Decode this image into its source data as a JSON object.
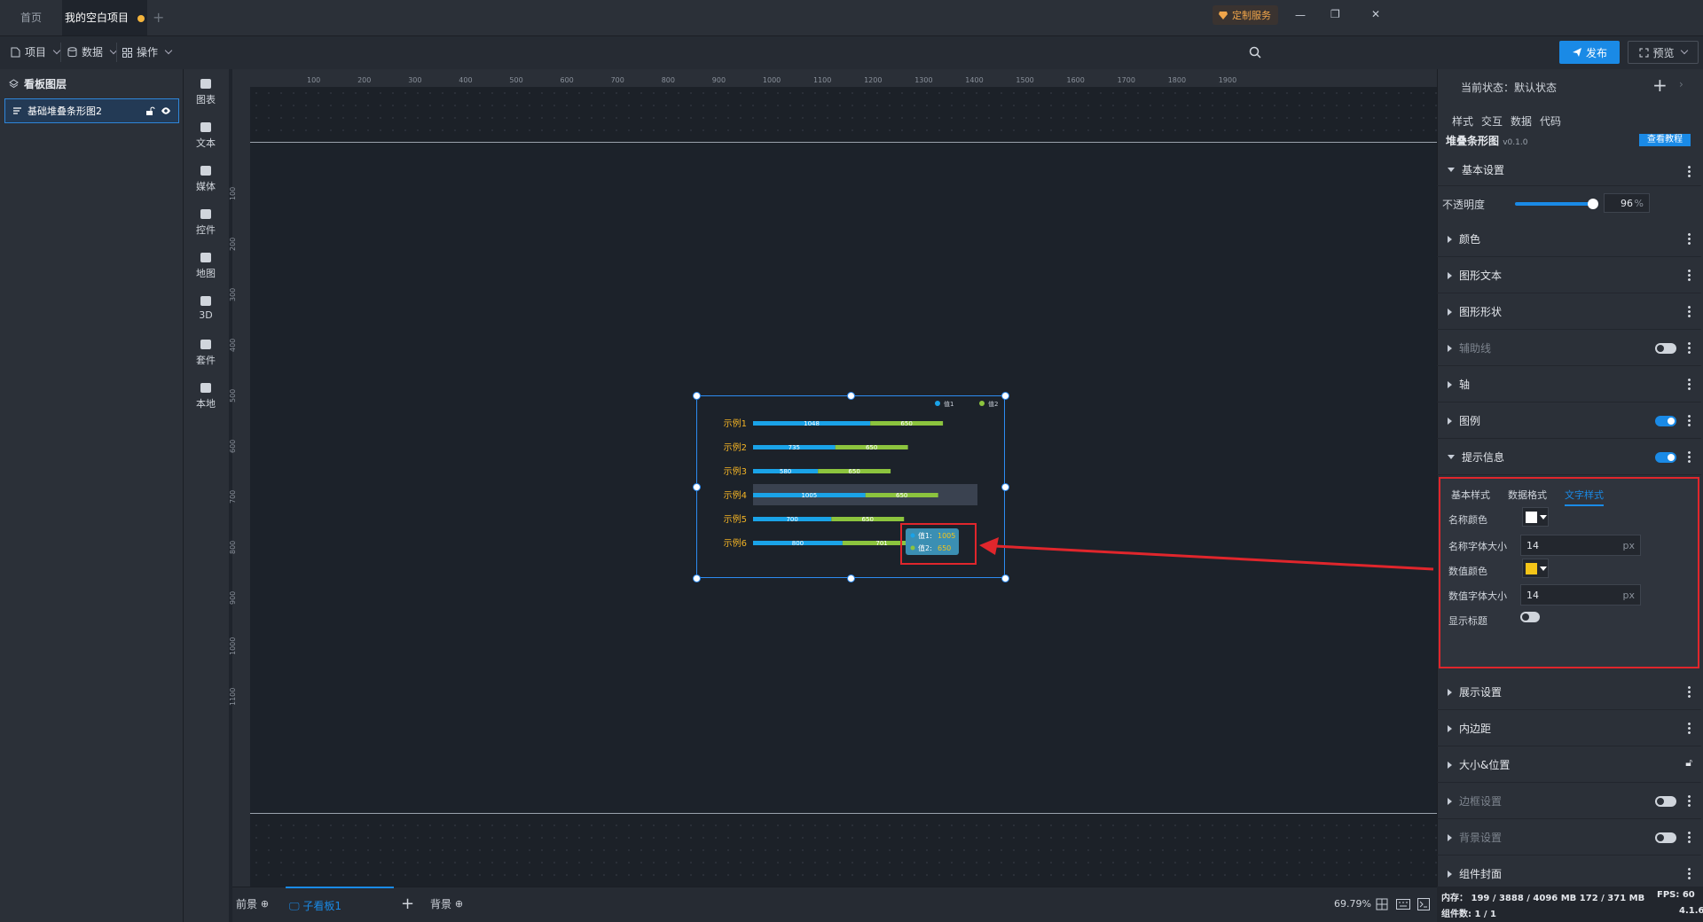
{
  "tabs": {
    "home": "首页",
    "project": "我的空白项目",
    "add": "+"
  },
  "window": {
    "service": "定制服务",
    "minimize": "—",
    "restore": "❐",
    "close": "✕"
  },
  "toolbar": {
    "project": "项目",
    "data": "数据",
    "operate": "操作",
    "publish": "发布",
    "preview": "预览"
  },
  "layers": {
    "title": "看板图层",
    "item": "基础堆叠条形图2"
  },
  "components": [
    "图表",
    "文本",
    "媒体",
    "控件",
    "地图",
    "3D",
    "套件",
    "本地"
  ],
  "ruler": {
    "top": [
      "100",
      "200",
      "300",
      "400",
      "500",
      "600",
      "700",
      "800",
      "900",
      "1000",
      "1100",
      "1200",
      "1300",
      "1400",
      "1500",
      "1600",
      "1700",
      "1800",
      "1900"
    ],
    "left": [
      "100",
      "200",
      "300",
      "400",
      "500",
      "600",
      "700",
      "800",
      "900",
      "1000",
      "1100"
    ]
  },
  "chart_data": {
    "type": "bar",
    "orientation": "horizontal",
    "stacked": true,
    "categories": [
      "示例1",
      "示例2",
      "示例3",
      "示例4",
      "示例5",
      "示例6"
    ],
    "series": [
      {
        "name": "值1",
        "values": [
          1048,
          735,
          580,
          1005,
          700,
          800
        ],
        "color": "#1aa3e8"
      },
      {
        "name": "值2",
        "values": [
          650,
          650,
          650,
          650,
          650,
          701
        ],
        "color": "#8cc43e"
      }
    ],
    "category_label_color": "#f2b325",
    "legend_position": "top-right",
    "xlim": [
      0,
      2300
    ],
    "highlighted_category": "示例4",
    "tooltip": {
      "row1_label": "值1:",
      "row1_value": "1005",
      "row2_label": "值2:",
      "row2_value": "650"
    }
  },
  "bottom": {
    "foreground": "前景",
    "subboard": "子看板1",
    "add": "+",
    "background": "背景",
    "zoom": "69.79%"
  },
  "panel": {
    "state": "当前状态：默认状态",
    "tabs": [
      "样式",
      "交互",
      "数据",
      "代码"
    ],
    "component_name": "堆叠条形图",
    "version": "v0.1.0",
    "tutorial": "查看教程",
    "basic": "基本设置",
    "opacity_label": "不透明度",
    "opacity_value": "96",
    "opacity_level": 0.96,
    "opacity_unit": "%",
    "sections_top": [
      "颜色",
      "图形文本",
      "图形形状",
      "辅助线",
      "轴",
      "图例",
      "提示信息"
    ],
    "subtabs": [
      "基本样式",
      "数据格式",
      "文字样式"
    ],
    "name_color_label": "名称颜色",
    "name_color": "#ffffff",
    "name_size_label": "名称字体大小",
    "name_size": "14",
    "unit": "px",
    "value_color_label": "数值颜色",
    "value_color": "#f5c518",
    "value_size_label": "数值字体大小",
    "value_size": "14",
    "show_title_label": "显示标题",
    "sections_bottom": [
      "展示设置",
      "内边距",
      "大小&位置",
      "边框设置",
      "背景设置",
      "组件封面"
    ]
  },
  "status": {
    "memory": "内存： 199 / 3888 / 4096 MB  172 / 371 MB",
    "fps": "FPS:  60",
    "count": "组件数: 1 / 1",
    "version": "4.1.6"
  }
}
